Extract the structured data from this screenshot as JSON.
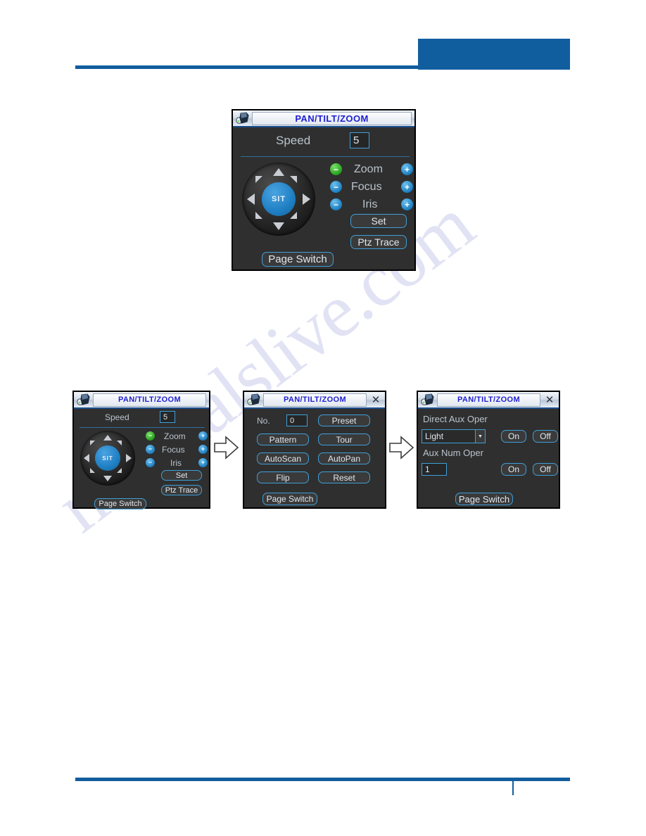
{
  "page": {
    "watermark_text": "manualslive.com",
    "accent_color": "#115e9f",
    "dialog_bg": "#2f2f2f",
    "dialog_accent": "#3f9fd8"
  },
  "dialog_title": "PAN/TILT/ZOOM",
  "close_glyph": "✕",
  "main_dialog": {
    "title": "PAN/TILT/ZOOM",
    "speed_label": "Speed",
    "speed_value": "5",
    "joystick_center_label": "SIT",
    "controls": [
      {
        "label": "Zoom",
        "minus": "−",
        "plus": "+",
        "minus_color": "green"
      },
      {
        "label": "Focus",
        "minus": "−",
        "plus": "+",
        "minus_color": "blue"
      },
      {
        "label": "Iris",
        "minus": "−",
        "plus": "+",
        "minus_color": "blue"
      }
    ],
    "set_label": "Set",
    "ptz_trace_label": "Ptz Trace",
    "page_switch_label": "Page Switch"
  },
  "step1_dialog": {
    "title": "PAN/TILT/ZOOM",
    "speed_label": "Speed",
    "speed_value": "5",
    "joystick_center_label": "SIT",
    "controls": [
      {
        "label": "Zoom",
        "minus": "−",
        "plus": "+",
        "minus_color": "green"
      },
      {
        "label": "Focus",
        "minus": "−",
        "plus": "+",
        "minus_color": "blue"
      },
      {
        "label": "Iris",
        "minus": "−",
        "plus": "+",
        "minus_color": "blue"
      }
    ],
    "set_label": "Set",
    "ptz_trace_label": "Ptz Trace",
    "page_switch_label": "Page Switch"
  },
  "step2_dialog": {
    "title": "PAN/TILT/ZOOM",
    "no_label": "No.",
    "no_value": "0",
    "buttons": {
      "preset": "Preset",
      "pattern": "Pattern",
      "tour": "Tour",
      "autoscan": "AutoScan",
      "autopan": "AutoPan",
      "flip": "Flip",
      "reset": "Reset",
      "page_switch": "Page Switch"
    }
  },
  "step3_dialog": {
    "title": "PAN/TILT/ZOOM",
    "direct_aux_label": "Direct Aux Oper",
    "direct_aux_value": "Light",
    "direct_aux_on": "On",
    "direct_aux_off": "Off",
    "aux_num_label": "Aux Num Oper",
    "aux_num_value": "1",
    "aux_num_on": "On",
    "aux_num_off": "Off",
    "page_switch_label": "Page Switch"
  }
}
